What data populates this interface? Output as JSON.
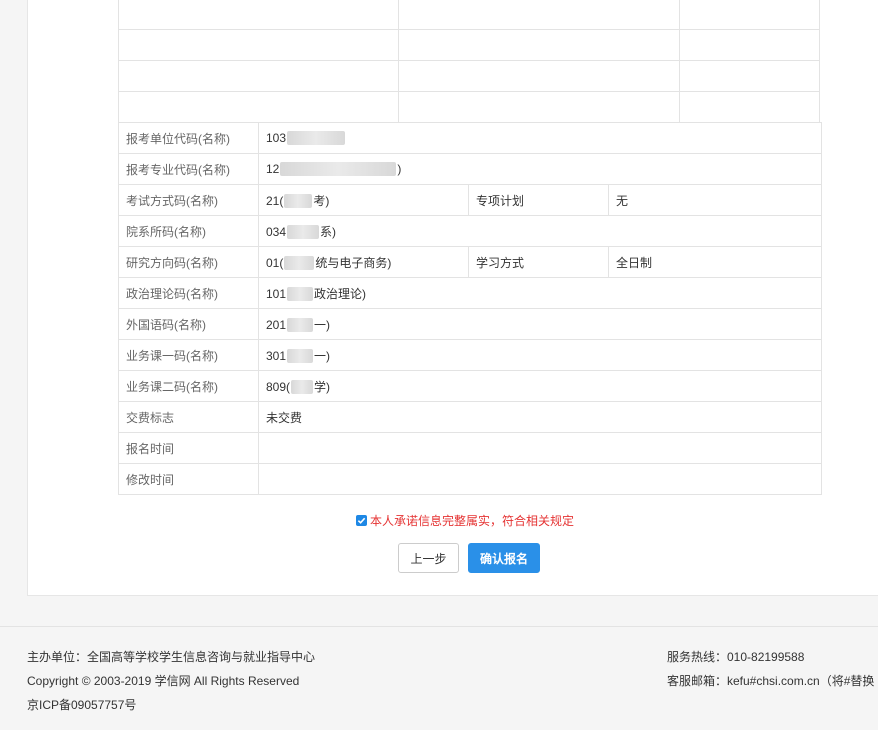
{
  "form": {
    "rows": [
      {
        "label": "报考单位代码(名称)",
        "value": "103",
        "blur": true
      },
      {
        "label": "报考专业代码(名称)",
        "value": "12",
        "tail": ")",
        "blur": true
      },
      {
        "label": "考试方式码(名称)",
        "value": "21(",
        "tail": "考)",
        "extra_label": "专项计划",
        "extra_value": "无"
      },
      {
        "label": "院系所码(名称)",
        "value": "034",
        "tail": "系)"
      },
      {
        "label": "研究方向码(名称)",
        "value": "01(",
        "tail": "统与电子商务)",
        "extra_label": "学习方式",
        "extra_value": "全日制"
      },
      {
        "label": "政治理论码(名称)",
        "value": "101",
        "tail": "政治理论)"
      },
      {
        "label": "外国语码(名称)",
        "value": "201",
        "tail": "一)"
      },
      {
        "label": "业务课一码(名称)",
        "value": "301",
        "tail": "一)"
      },
      {
        "label": "业务课二码(名称)",
        "value": "809(",
        "tail": "学)"
      },
      {
        "label": "交费标志",
        "value": "未交费"
      },
      {
        "label": "报名时间",
        "value": ""
      },
      {
        "label": "修改时间",
        "value": ""
      }
    ]
  },
  "commitment": {
    "text": "本人承诺信息完整属实，符合相关规定",
    "checked": true
  },
  "buttons": {
    "prev": "上一步",
    "confirm": "确认报名"
  },
  "footer": {
    "organizer": "主办单位：全国高等学校学生信息咨询与就业指导中心",
    "copyright": "Copyright © 2003-2019 学信网 All Rights Reserved",
    "icp": "京ICP备09057757号",
    "hotline": "服务热线：010-82199588",
    "email": "客服邮箱：kefu#chsi.com.cn（将#替换"
  },
  "colors": {
    "accent": "#2a90e8",
    "warning": "#e53333"
  }
}
